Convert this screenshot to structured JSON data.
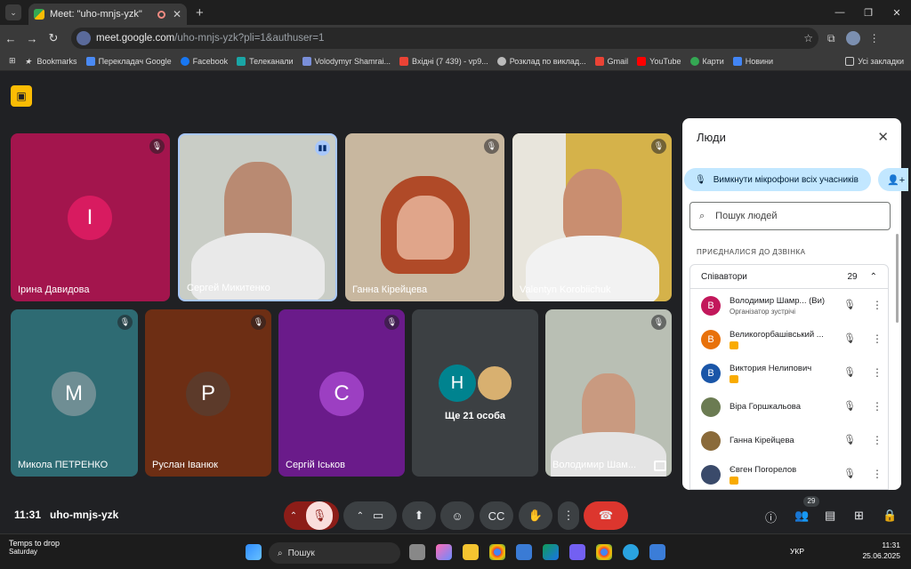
{
  "browser": {
    "tab_title": "Meet: \"uho-mnjs-yzk\"",
    "url_host": "meet.google.com",
    "url_path": "/uho-mnjs-yzk?pli=1&authuser=1",
    "bookmarks": [
      "Bookmarks",
      "Перекладач Google",
      "Facebook",
      "Телеканали",
      "Volodymyr Shamrai...",
      "Вхідні (7 439) - vp9...",
      "Розклад по виклад...",
      "Gmail",
      "YouTube",
      "Карти",
      "Новини"
    ],
    "bookmarks_folder": "Усі закладки"
  },
  "tiles": [
    {
      "name": "Ірина Давидова",
      "initial": "І",
      "bg": "#a3154d",
      "avatar": "#d81b60",
      "muted": true
    },
    {
      "name": "Сергей Микитенко",
      "speaking": true
    },
    {
      "name": "Ганна Кірейцева",
      "muted": true
    },
    {
      "name": "Valentyn Korobiichuk",
      "muted": true
    },
    {
      "name": "Микола ПЕТРЕНКО",
      "initial": "М",
      "bg": "#2e6b73",
      "avatar": "#6f8e94",
      "muted": true
    },
    {
      "name": "Руслан Іванюк",
      "initial": "Р",
      "bg": "#6d2e14",
      "avatar": "#5c3a2a",
      "muted": true
    },
    {
      "name": "Сергій Іськов",
      "initial": "С",
      "bg": "#6a1b8a",
      "avatar": "#9c3fc2",
      "muted": true
    },
    {
      "name": "Ще 21 особа",
      "initial": "Н"
    },
    {
      "name": "Володимир Шам...",
      "muted": true
    }
  ],
  "meeting": {
    "time": "11:31",
    "code": "uho-mnjs-yzk",
    "people_count": "29"
  },
  "panel": {
    "title": "Люди",
    "mute_all": "Вимкнути мікрофони всіх учасників",
    "search_placeholder": "Пошук людей",
    "section": "ПРИЄДНАЛИСЯ ДО ДЗВІНКА",
    "group": "Співавтори",
    "group_count": "29",
    "people": [
      {
        "name": "Володимир Шамр...  (Ви)",
        "sub": "Організатор зустрічі",
        "initial": "В",
        "color": "#c2185b"
      },
      {
        "name": "Великогорбашівський ...",
        "initial": "В",
        "color": "#e8710a",
        "badge": true
      },
      {
        "name": "Виктория Нелипович",
        "initial": "В",
        "color": "#1a56a8",
        "badge": true
      },
      {
        "name": "Віра Горшкальова",
        "initial": "",
        "color": "#6b7b52"
      },
      {
        "name": "Ганна Кірейцева",
        "initial": "",
        "color": "#8a6a3a"
      },
      {
        "name": "Євген Погорелов",
        "initial": "",
        "color": "#3a4a6a",
        "badge": true
      }
    ]
  },
  "taskbar": {
    "weather_title": "Temps to drop",
    "weather_sub": "Saturday",
    "search": "Пошук",
    "lang": "УКР",
    "time": "11:31",
    "date": "25.06.2025"
  }
}
